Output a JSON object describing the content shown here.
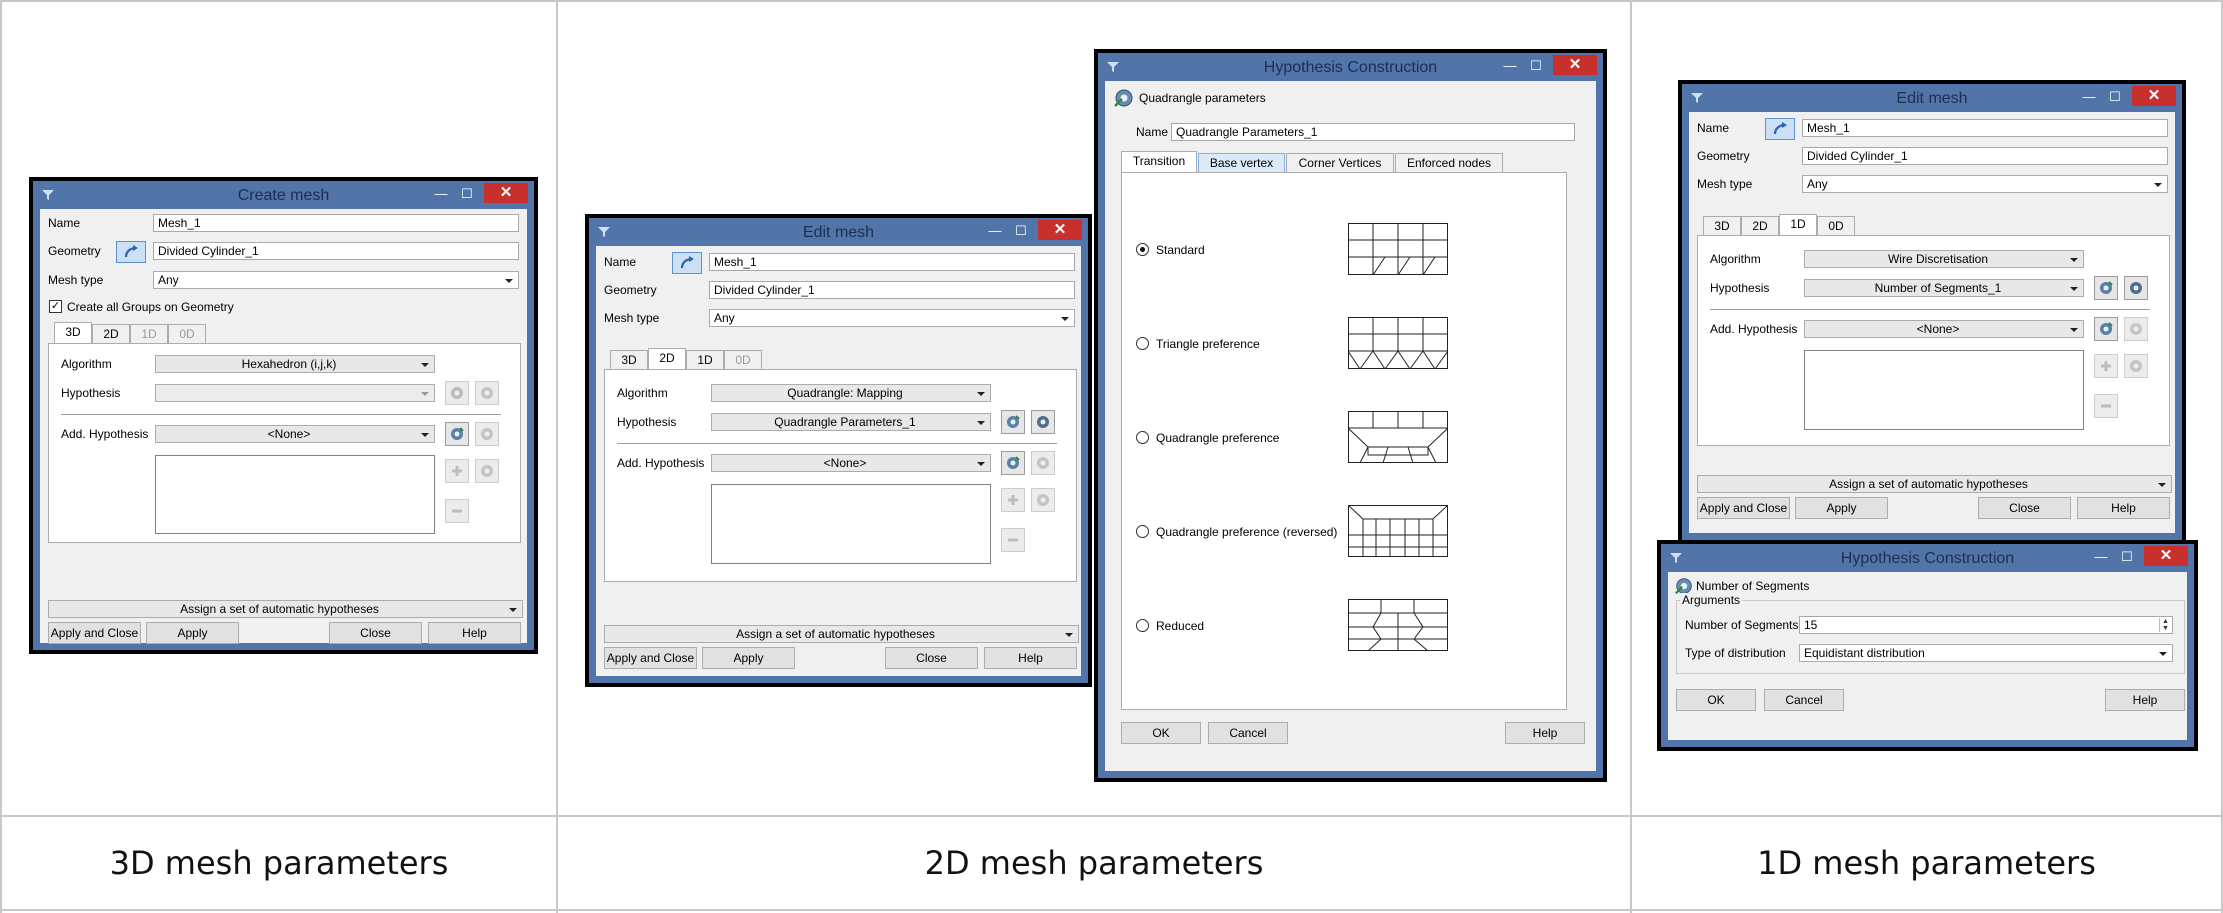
{
  "captions": {
    "col1": "3D mesh parameters",
    "col2": "2D mesh parameters",
    "col3": "1D mesh parameters"
  },
  "colors": {
    "window_frame": "#5174a9",
    "close_button": "#c7302c",
    "dialog_bg": "#f0f0f0"
  },
  "icons": {
    "title": "funnel-icon",
    "geometry": "select-arrow-icon",
    "hyp_create": "gear-icon",
    "hyp_edit": "gear-edit-icon",
    "add": "plus-icon",
    "remove": "minus-icon"
  },
  "common": {
    "minimize": "—",
    "maximize": "☐",
    "close": "✕",
    "name_label": "Name",
    "geometry_label": "Geometry",
    "mesh_type_label": "Mesh type",
    "algorithm_label": "Algorithm",
    "hypothesis_label": "Hypothesis",
    "add_hypothesis_label": "Add. Hypothesis",
    "tabs": [
      "3D",
      "2D",
      "1D",
      "0D"
    ],
    "assign_label": "Assign a set of automatic hypotheses",
    "apply_close_label": "Apply and Close",
    "apply_label": "Apply",
    "close_label": "Close",
    "help_label": "Help"
  },
  "create_mesh": {
    "title": "Create mesh",
    "name": "Mesh_1",
    "geometry": "Divided Cylinder_1",
    "mesh_type": "Any",
    "groups_check_label": "Create all Groups on Geometry",
    "groups_checked": "✓",
    "algorithm": "Hexahedron (i,j,k)",
    "hypothesis": "",
    "add_hypothesis": "<None>"
  },
  "edit_mesh_2d": {
    "title": "Edit mesh",
    "name": "Mesh_1",
    "geometry": "Divided Cylinder_1",
    "mesh_type": "Any",
    "algorithm": "Quadrangle: Mapping",
    "hypothesis": "Quadrangle Parameters_1",
    "add_hypothesis": "<None>"
  },
  "hyp_quad": {
    "title": "Hypothesis Construction",
    "header": "Quadrangle parameters",
    "name_label": "Name",
    "name": "Quadrangle Parameters_1",
    "tabs": [
      "Transition",
      "Base vertex",
      "Corner Vertices",
      "Enforced nodes"
    ],
    "options": [
      "Standard",
      "Triangle preference",
      "Quadrangle preference",
      "Quadrangle preference (reversed)",
      "Reduced"
    ],
    "selected": "Standard",
    "ok_label": "OK",
    "cancel_label": "Cancel",
    "help_label": "Help"
  },
  "edit_mesh_1d": {
    "title": "Edit mesh",
    "name": "Mesh_1",
    "geometry": "Divided Cylinder_1",
    "mesh_type": "Any",
    "algorithm": "Wire Discretisation",
    "hypothesis": "Number of Segments_1",
    "add_hypothesis": "<None>"
  },
  "hyp_seg": {
    "title": "Hypothesis Construction",
    "header": "Number of Segments",
    "group_label": "Arguments",
    "segments_label": "Number of Segments",
    "segments_value": "15",
    "distribution_label": "Type of distribution",
    "distribution_value": "Equidistant distribution",
    "ok_label": "OK",
    "cancel_label": "Cancel",
    "help_label": "Help"
  }
}
